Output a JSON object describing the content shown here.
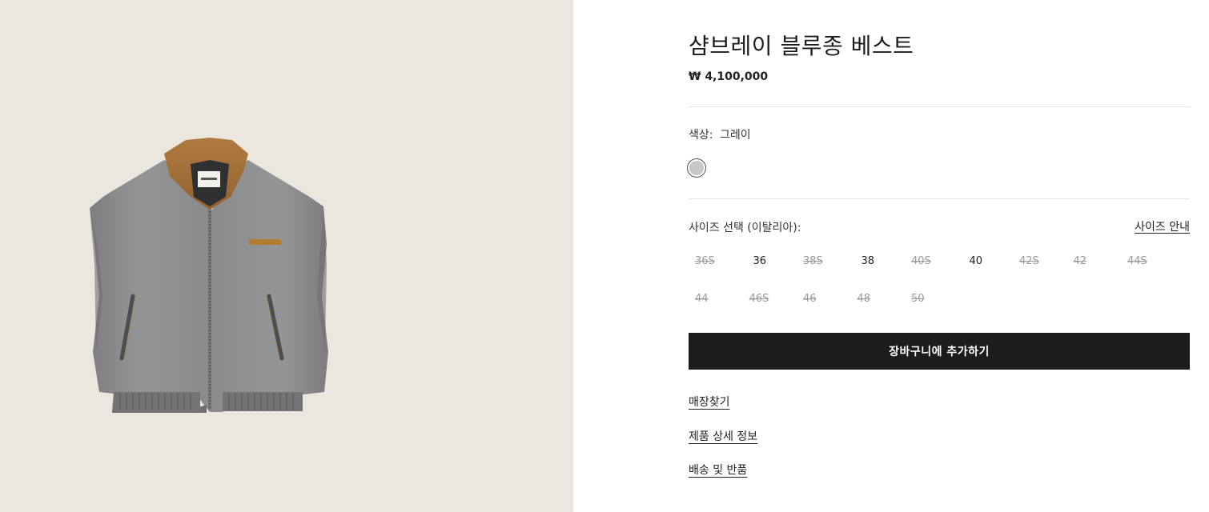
{
  "product": {
    "title": "샴브레이 블루종 베스트",
    "price": "₩ 4,100,000"
  },
  "color": {
    "label": "색상:",
    "value": "그레이",
    "swatches": [
      {
        "name": "그레이",
        "hex": "#c6c6c6",
        "selected": true
      }
    ]
  },
  "size": {
    "label": "사이즈 선택 (이탈리아):",
    "guide_link": "사이즈 안내",
    "options": [
      {
        "label": "36S",
        "available": false
      },
      {
        "label": "36",
        "available": true
      },
      {
        "label": "38S",
        "available": false
      },
      {
        "label": "38",
        "available": true
      },
      {
        "label": "40S",
        "available": false
      },
      {
        "label": "40",
        "available": true
      },
      {
        "label": "42S",
        "available": false
      },
      {
        "label": "42",
        "available": false
      },
      {
        "label": "44S",
        "available": false
      },
      {
        "label": "44",
        "available": false
      },
      {
        "label": "46S",
        "available": false
      },
      {
        "label": "46",
        "available": false
      },
      {
        "label": "48",
        "available": false
      },
      {
        "label": "50",
        "available": false
      }
    ]
  },
  "actions": {
    "add_to_cart": "장바구니에 추가하기"
  },
  "links": {
    "store_finder": "매장찾기",
    "product_details": "제품 상세 정보",
    "shipping_returns": "배송 및 반품"
  },
  "colors": {
    "image_background": "#ebe7df",
    "vest_grey": "#8e8e8f",
    "collar_brown": "#a8733c",
    "button_black": "#1c1c1c"
  }
}
